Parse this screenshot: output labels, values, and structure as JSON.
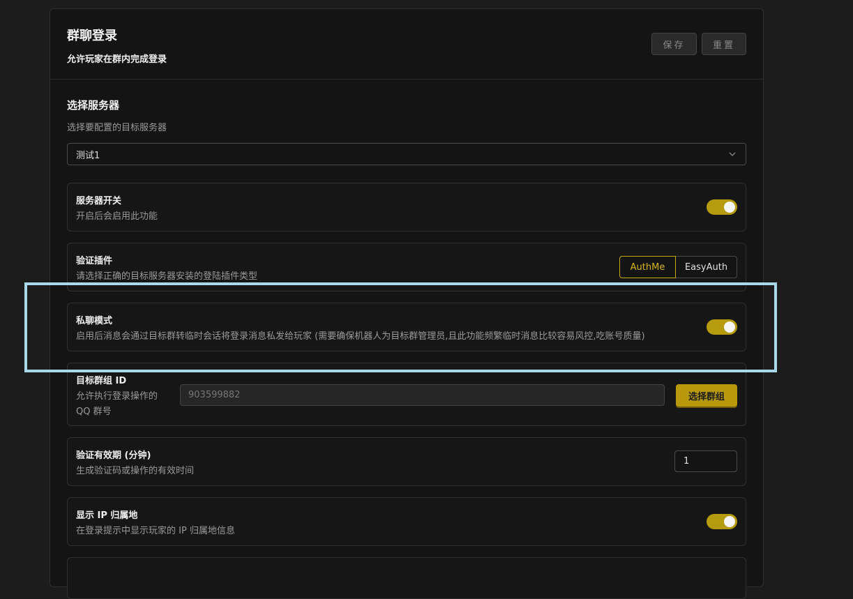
{
  "header": {
    "title": "群聊登录",
    "subtitle": "允许玩家在群内完成登录",
    "save_label": "保存",
    "reset_label": "重置"
  },
  "server_section": {
    "title": "选择服务器",
    "desc": "选择要配置的目标服务器",
    "selected": "测试1"
  },
  "rows": {
    "server_switch": {
      "label": "服务器开关",
      "desc": "开启后会启用此功能",
      "enabled": true
    },
    "auth_plugin": {
      "label": "验证插件",
      "desc": "请选择正确的目标服务器安装的登陆插件类型",
      "options": [
        "AuthMe",
        "EasyAuth"
      ],
      "selected": "AuthMe"
    },
    "private_mode": {
      "label": "私聊模式",
      "desc": "启用后消息会通过目标群转临时会话将登录消息私发给玩家 (需要确保机器人为目标群管理员,且此功能频繁临时消息比较容易风控,吃账号质量)",
      "enabled": true
    },
    "target_group": {
      "label": "目标群组 ID",
      "desc_line1": "允许执行登录操作的",
      "desc_line2": "QQ 群号",
      "value": "903599882",
      "button_label": "选择群组"
    },
    "validity": {
      "label": "验证有效期 (分钟)",
      "desc": "生成验证码或操作的有效时间",
      "value": "1"
    },
    "show_ip": {
      "label": "显示 IP 归属地",
      "desc": "在登录提示中显示玩家的 IP 归属地信息",
      "enabled": true
    }
  },
  "colors": {
    "accent": "#b69b0e",
    "highlight": "#a8d8ea"
  },
  "icons": {
    "select_chevron": "chevron-down-icon"
  }
}
